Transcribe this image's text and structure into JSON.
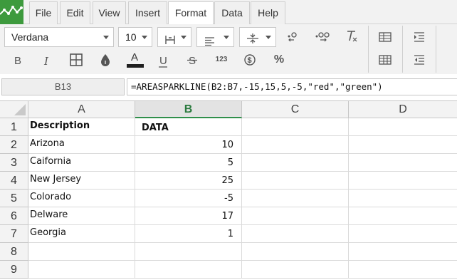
{
  "menu": {
    "items": [
      {
        "label": "File"
      },
      {
        "label": "Edit"
      },
      {
        "label": "View"
      },
      {
        "label": "Insert"
      },
      {
        "label": "Format",
        "active": true
      },
      {
        "label": "Data"
      },
      {
        "label": "Help"
      }
    ]
  },
  "toolbar": {
    "font_family": "Verdana",
    "font_size": "10",
    "format_number_label": "123",
    "percent_label": "%",
    "text_color": "#1f1f1f",
    "icons": [
      "borders-icon",
      "horizontal-align-icon",
      "vertical-align-icon",
      "decrease-decimal-icon",
      "increase-decimal-icon",
      "clear-format-icon",
      "insert-table-icon",
      "indent-icon",
      "bold-icon",
      "italic-icon",
      "cell-borders-icon",
      "fill-color-icon",
      "text-color-icon",
      "underline-icon",
      "strikethrough-icon",
      "number-format-icon",
      "currency-icon",
      "percent-icon",
      "delete-table-icon",
      "outdent-icon"
    ]
  },
  "formula_bar": {
    "cell_ref": "B13",
    "formula": "=AREASPARKLINE(B2:B7,-15,15,5,-5,\"red\",\"green\")"
  },
  "grid": {
    "columns": [
      "A",
      "B",
      "C",
      "D"
    ],
    "selected_column": "B",
    "rows": [
      "1",
      "2",
      "3",
      "4",
      "5",
      "6",
      "7",
      "8",
      "9"
    ],
    "cells": {
      "A1": "Description",
      "B1": "DATA",
      "A2": "Arizona",
      "B2": "10",
      "A3": "Caifornia",
      "B3": "5",
      "A4": "New Jersey",
      "B4": "25",
      "A5": "Colorado",
      "B5": "-5",
      "A6": "Delware",
      "B6": "17",
      "A7": "Georgia",
      "B7": "1"
    }
  },
  "colors": {
    "brand": "#3d9a3d",
    "selected_header_accent": "#2f8f4a"
  }
}
